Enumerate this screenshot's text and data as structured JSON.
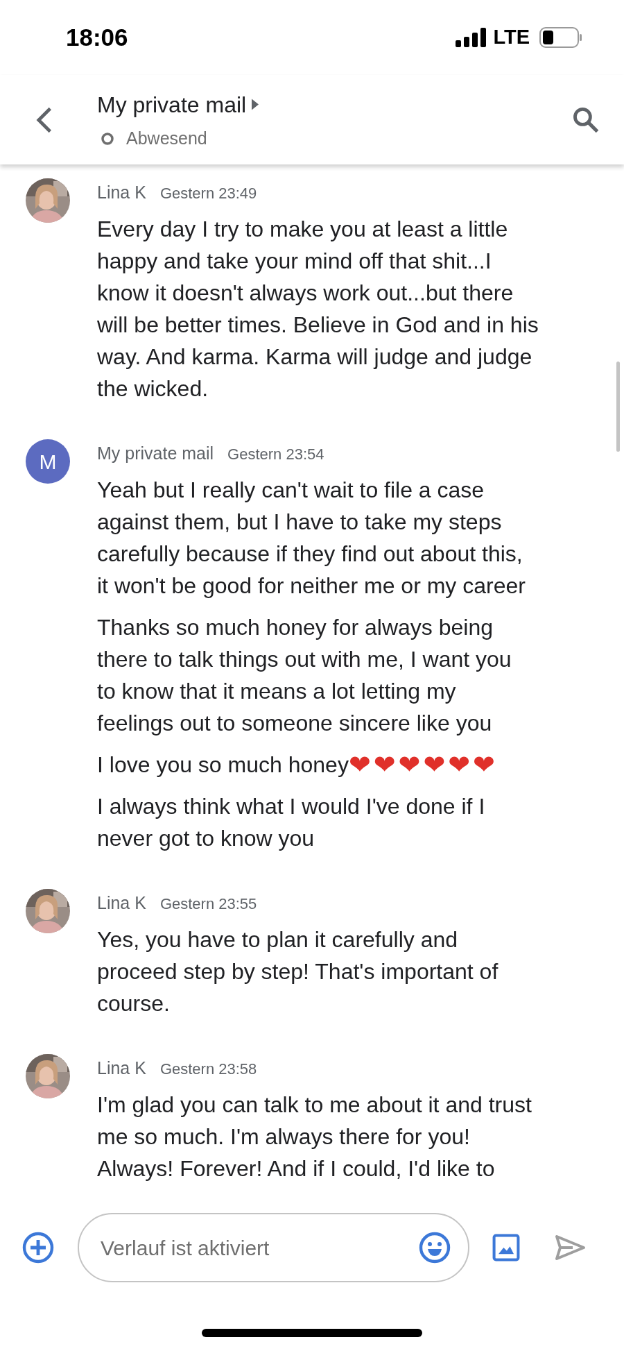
{
  "status_bar": {
    "time": "18:06",
    "network": "LTE"
  },
  "header": {
    "title": "My private mail",
    "status": "Abwesend"
  },
  "messages": [
    {
      "sender": "Lina K",
      "time": "Gestern 23:49",
      "avatar": {
        "kind": "picture"
      },
      "paragraphs": [
        {
          "lines": [
            "Every day I try to make you at least a little",
            "happy and take your mind off that shit...I",
            "know it doesn't always work out...but there",
            "will be better times. Believe in God and in his",
            "way. And karma. Karma will judge and judge",
            "the wicked."
          ]
        }
      ]
    },
    {
      "sender": "My private mail",
      "time": "Gestern 23:54",
      "avatar": {
        "kind": "letter",
        "letter": "M"
      },
      "paragraphs": [
        {
          "lines": [
            "Yeah but I really can't wait to file a case",
            "against them, but I have to take my steps",
            "carefully because if they find out about this,",
            "it won't be good for neither me or my career"
          ]
        },
        {
          "lines": [
            "Thanks so much honey for always being",
            "there to talk things out with me, I want you",
            "to know that it means a lot letting my",
            "feelings out to someone sincere like you"
          ]
        },
        {
          "lines": [
            "I love you so much honey"
          ],
          "emoji": "❤❤❤❤❤❤"
        },
        {
          "lines": [
            "I always think what I would I've done if I",
            "never got to know you"
          ]
        }
      ]
    },
    {
      "sender": "Lina K",
      "time": "Gestern 23:55",
      "avatar": {
        "kind": "picture"
      },
      "paragraphs": [
        {
          "lines": [
            "Yes, you have to plan it carefully and",
            "proceed step by step! That's important of",
            "course."
          ]
        }
      ]
    },
    {
      "sender": "Lina K",
      "time": "Gestern 23:58",
      "avatar": {
        "kind": "picture"
      },
      "paragraphs": [
        {
          "lines": [
            "I'm glad you can talk to me about it and trust",
            "me so much. I'm always there for you!",
            "Always! Forever! And if I could, I'd like to"
          ]
        }
      ]
    }
  ],
  "composer": {
    "placeholder": "Verlauf ist aktiviert"
  }
}
